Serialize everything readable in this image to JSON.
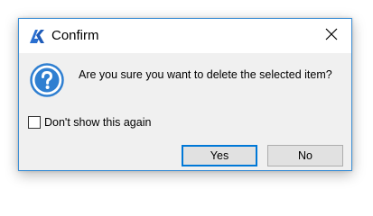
{
  "window": {
    "title": "Confirm",
    "app_icon": "bricscad-logo-icon",
    "close_icon": "close-icon"
  },
  "dialog": {
    "icon": "question-icon",
    "message": "Are you sure you want to delete the selected item?",
    "checkbox": {
      "label": "Don't show this again",
      "checked": false
    },
    "buttons": {
      "yes_label": "Yes",
      "no_label": "No"
    }
  },
  "colors": {
    "accent": "#0078d7",
    "question_blue": "#2f7fd1",
    "dialog_bg": "#f0f0f0"
  }
}
